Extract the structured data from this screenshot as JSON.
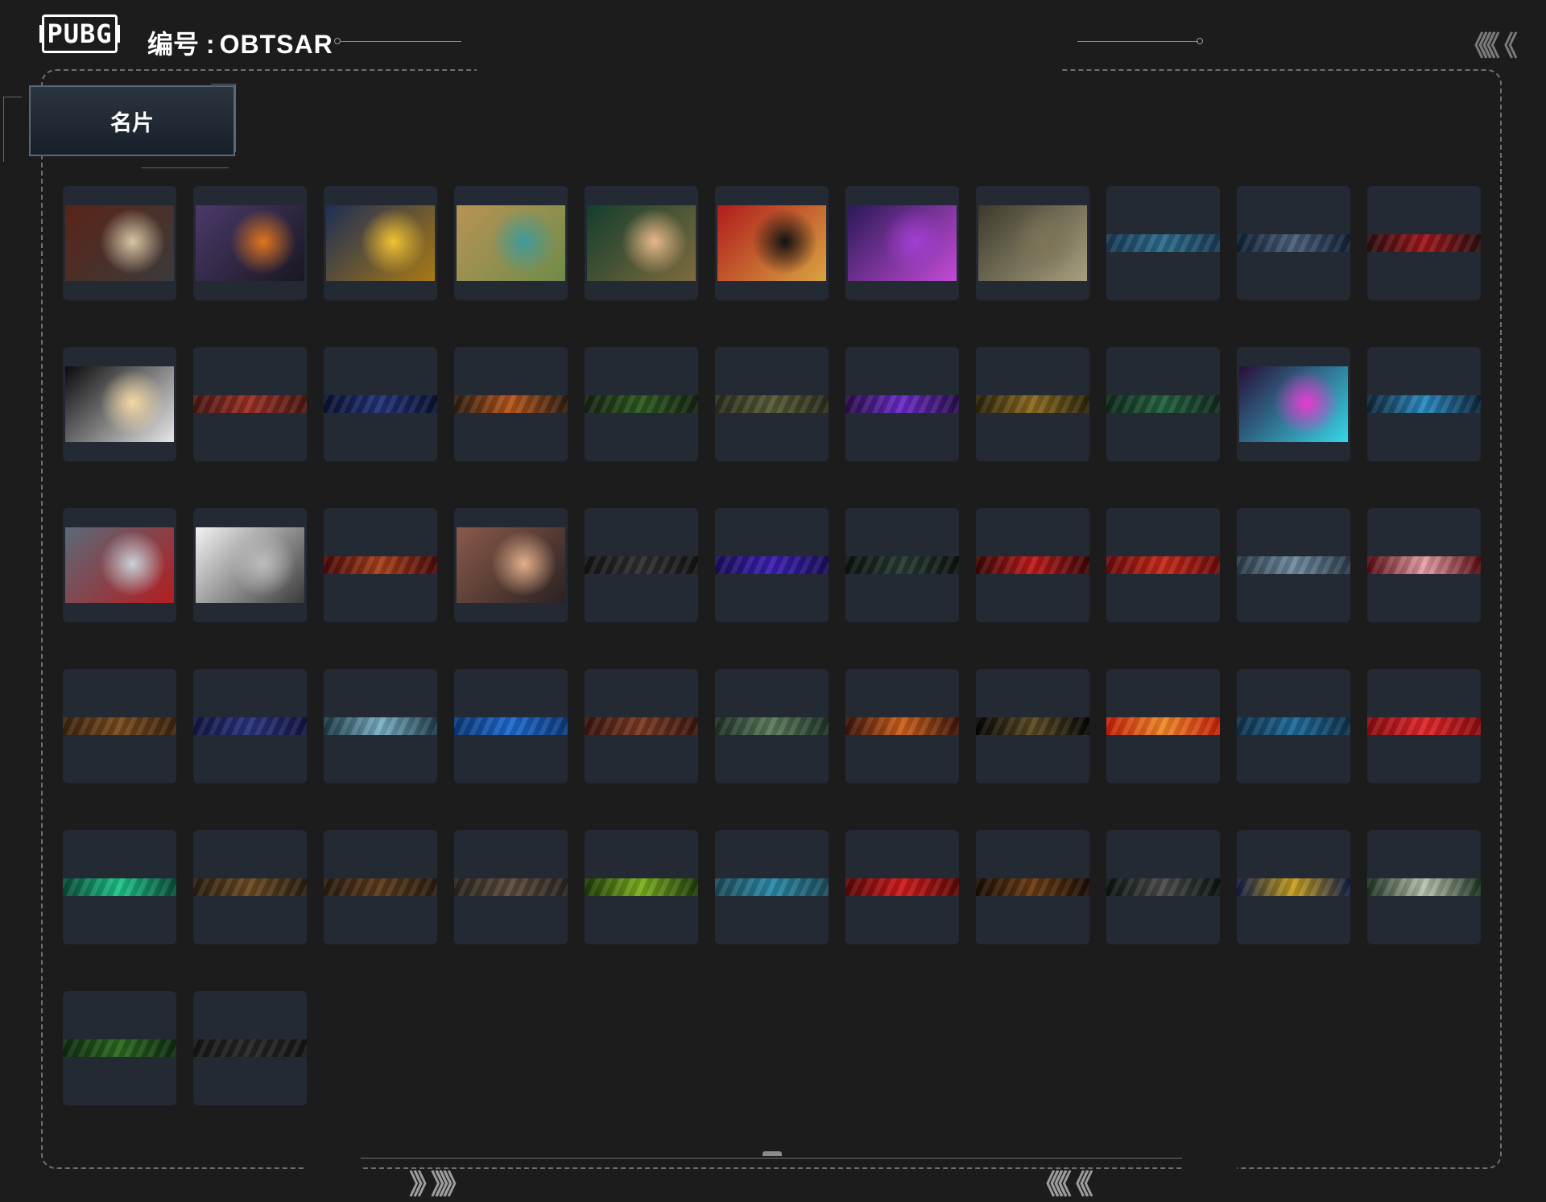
{
  "header": {
    "logo_text": "PUBG",
    "title_label": "编号 :",
    "player_id": "OBTSAR"
  },
  "tab": {
    "label": "名片"
  },
  "decor": {
    "top_right_chevrons": "《《《《 《",
    "bottom_left_chevrons": "》》 》》》》",
    "bottom_right_chevrons": "《《《《 《《"
  },
  "cards": [
    {
      "kind": "image",
      "colors": [
        "#5a2418",
        "#d8c6a5",
        "#3b3b3b"
      ]
    },
    {
      "kind": "image",
      "colors": [
        "#4a3a6a",
        "#e0751d",
        "#1a1722"
      ]
    },
    {
      "kind": "image",
      "colors": [
        "#1f2e55",
        "#f1c232",
        "#a87a16"
      ]
    },
    {
      "kind": "image",
      "colors": [
        "#b89355",
        "#3f9a9a",
        "#6f8c4a"
      ]
    },
    {
      "kind": "image",
      "colors": [
        "#143e2d",
        "#e8b88a",
        "#7e6b3d"
      ]
    },
    {
      "kind": "image",
      "colors": [
        "#b01c1c",
        "#111111",
        "#d9a441"
      ]
    },
    {
      "kind": "image",
      "colors": [
        "#2b1a57",
        "#a23ed1",
        "#c34bd6"
      ]
    },
    {
      "kind": "image",
      "colors": [
        "#3b3a2c",
        "#7d7454",
        "#a89f7f"
      ]
    },
    {
      "kind": "banner",
      "colors": [
        "#1a3a55",
        "#2d6b8c"
      ]
    },
    {
      "kind": "banner",
      "colors": [
        "#102033",
        "#4a5e7a"
      ]
    },
    {
      "kind": "banner",
      "colors": [
        "#2a0f12",
        "#a0161a"
      ]
    },
    {
      "kind": "image",
      "colors": [
        "#0b0b0b",
        "#f4d8a5",
        "#e6e6e6"
      ]
    },
    {
      "kind": "banner",
      "colors": [
        "#4a1814",
        "#9c2f24"
      ]
    },
    {
      "kind": "banner",
      "colors": [
        "#0a1230",
        "#23327a"
      ]
    },
    {
      "kind": "banner",
      "colors": [
        "#2c1e12",
        "#b8551a"
      ]
    },
    {
      "kind": "banner",
      "colors": [
        "#152112",
        "#2c5a1f"
      ]
    },
    {
      "kind": "banner",
      "colors": [
        "#2a2d1c",
        "#565a35"
      ]
    },
    {
      "kind": "banner",
      "colors": [
        "#2a0f4a",
        "#6a2ac8"
      ]
    },
    {
      "kind": "banner",
      "colors": [
        "#2c230d",
        "#8a6a1e"
      ]
    },
    {
      "kind": "banner",
      "colors": [
        "#102a1c",
        "#23603e"
      ]
    },
    {
      "kind": "image",
      "colors": [
        "#2a0f3a",
        "#e83bd0",
        "#36d6e8"
      ]
    },
    {
      "kind": "banner",
      "colors": [
        "#0f2538",
        "#2a8ac4"
      ]
    },
    {
      "kind": "image",
      "colors": [
        "#5a6a78",
        "#c9d2d8",
        "#b31d20"
      ]
    },
    {
      "kind": "image",
      "colors": [
        "#f2f2f2",
        "#bdbdbd",
        "#3a3a3a"
      ]
    },
    {
      "kind": "banner",
      "colors": [
        "#4a0a0a",
        "#a8401a"
      ]
    },
    {
      "kind": "image",
      "colors": [
        "#8a5a4a",
        "#e2b08a",
        "#2a2222"
      ]
    },
    {
      "kind": "banner",
      "colors": [
        "#141414",
        "#2e2e2e"
      ]
    },
    {
      "kind": "banner",
      "colors": [
        "#1a0f5a",
        "#3b1fb3"
      ]
    },
    {
      "kind": "banner",
      "colors": [
        "#0a1410",
        "#263a30"
      ]
    },
    {
      "kind": "banner",
      "colors": [
        "#3a0808",
        "#c01a1a"
      ]
    },
    {
      "kind": "banner",
      "colors": [
        "#6a0c0c",
        "#c8281a"
      ]
    },
    {
      "kind": "banner",
      "colors": [
        "#2a3a48",
        "#6e8ca0"
      ]
    },
    {
      "kind": "banner",
      "colors": [
        "#5a0a12",
        "#e8a0a8"
      ]
    },
    {
      "kind": "banner",
      "colors": [
        "#3a2410",
        "#7a4a1c"
      ]
    },
    {
      "kind": "banner",
      "colors": [
        "#121640",
        "#2a3380"
      ]
    },
    {
      "kind": "banner",
      "colors": [
        "#1e3a48",
        "#7ab0c4"
      ]
    },
    {
      "kind": "banner",
      "colors": [
        "#0c3a7a",
        "#1e6ad0"
      ]
    },
    {
      "kind": "banner",
      "colors": [
        "#3a1510",
        "#7a3a22"
      ]
    },
    {
      "kind": "banner",
      "colors": [
        "#1e3224",
        "#5c7a5c"
      ]
    },
    {
      "kind": "banner",
      "colors": [
        "#3a140a",
        "#d0601a"
      ]
    },
    {
      "kind": "banner",
      "colors": [
        "#050505",
        "#5a4a22"
      ]
    },
    {
      "kind": "banner",
      "colors": [
        "#c8200a",
        "#f28a2a"
      ]
    },
    {
      "kind": "banner",
      "colors": [
        "#10304a",
        "#1e6a9a"
      ]
    },
    {
      "kind": "banner",
      "colors": [
        "#8a0c10",
        "#e2262a"
      ]
    },
    {
      "kind": "banner",
      "colors": [
        "#0a4a3a",
        "#1ec488"
      ]
    },
    {
      "kind": "banner",
      "colors": [
        "#2a1e10",
        "#6a4a22"
      ]
    },
    {
      "kind": "banner",
      "colors": [
        "#2a1c10",
        "#5a3a1a"
      ]
    },
    {
      "kind": "banner",
      "colors": [
        "#2a2420",
        "#5a4a3a"
      ]
    },
    {
      "kind": "banner",
      "colors": [
        "#1e3a0a",
        "#7ab01e"
      ]
    },
    {
      "kind": "banner",
      "colors": [
        "#1e4a5a",
        "#2a8aa8"
      ]
    },
    {
      "kind": "banner",
      "colors": [
        "#5a0808",
        "#d01a1a"
      ]
    },
    {
      "kind": "banner",
      "colors": [
        "#1a0e08",
        "#6a3a10"
      ]
    },
    {
      "kind": "banner",
      "colors": [
        "#0a1410",
        "#4a4a4a"
      ]
    },
    {
      "kind": "banner",
      "colors": [
        "#101c48",
        "#c8a01e"
      ]
    },
    {
      "kind": "banner",
      "colors": [
        "#1e3420",
        "#b8c4b0"
      ]
    },
    {
      "kind": "banner",
      "colors": [
        "#0e2a10",
        "#2a6a1e"
      ]
    },
    {
      "kind": "banner",
      "colors": [
        "#161616",
        "#242424"
      ]
    }
  ]
}
